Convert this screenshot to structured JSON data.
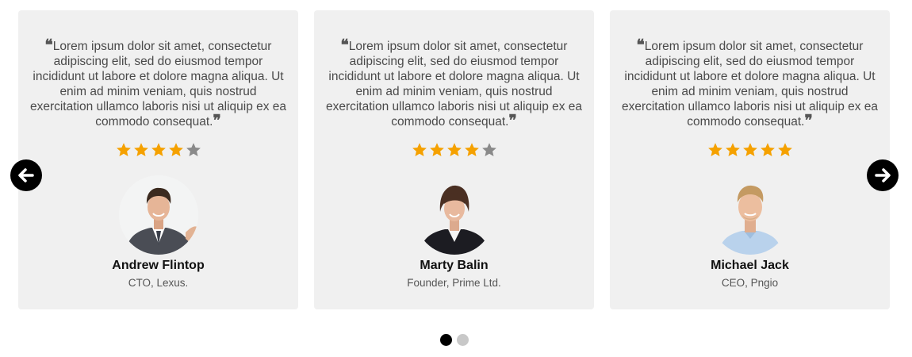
{
  "testimonials": [
    {
      "quote_open": "❝",
      "text": "Lorem ipsum dolor sit amet, consectetur adipiscing elit, sed do eiusmod tempor incididunt ut labore et dolore magna aliqua. Ut enim ad minim veniam, quis nostrud exercitation ullamco laboris nisi ut aliquip ex ea commodo consequat.",
      "quote_close": "❞",
      "rating": 4,
      "rating_max": 5,
      "name": "Andrew Flintop",
      "role": "CTO, Lexus.",
      "avatar": "man-in-suit-avatar"
    },
    {
      "quote_open": "❝",
      "text": "Lorem ipsum dolor sit amet, consectetur adipiscing elit, sed do eiusmod tempor incididunt ut labore et dolore magna aliqua. Ut enim ad minim veniam, quis nostrud exercitation ullamco laboris nisi ut aliquip ex ea commodo consequat.",
      "quote_close": "❞",
      "rating": 4,
      "rating_max": 5,
      "name": "Marty Balin",
      "role": "Founder, Prime Ltd.",
      "avatar": "woman-in-blazer-avatar"
    },
    {
      "quote_open": "❝",
      "text": "Lorem ipsum dolor sit amet, consectetur adipiscing elit, sed do eiusmod tempor incididunt ut labore et dolore magna aliqua. Ut enim ad minim veniam, quis nostrud exercitation ullamco laboris nisi ut aliquip ex ea commodo consequat.",
      "quote_close": "❞",
      "rating": 5,
      "rating_max": 5,
      "name": "Michael Jack",
      "role": "CEO, Pngio",
      "avatar": "man-in-shirt-avatar"
    }
  ],
  "navigation": {
    "prev_icon": "arrow-left-icon",
    "next_icon": "arrow-right-icon"
  },
  "pagination": {
    "pages": 2,
    "active": 1
  },
  "colors": {
    "card_bg": "#f0f0f0",
    "star_filled": "#f5a100",
    "star_empty": "#8a8a8a",
    "arrow_bg": "#000000",
    "dot_active": "#000000",
    "dot_inactive": "#c8c8c8"
  }
}
